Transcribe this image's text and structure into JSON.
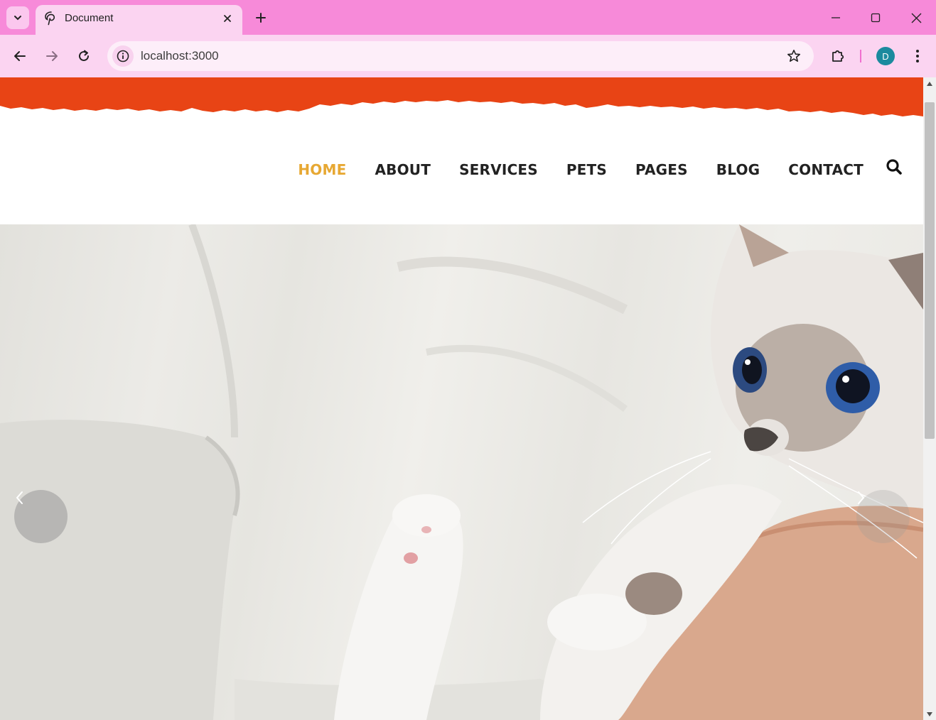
{
  "browser": {
    "tab_title": "Document",
    "url": "localhost:3000",
    "profile_initial": "D",
    "favicon": "pinterest-style-p-icon",
    "theme_color": "#f78ad9"
  },
  "site": {
    "accent_color": "#e84415",
    "active_color": "#e7a833",
    "nav": {
      "home": "HOME",
      "about": "ABOUT",
      "services": "SERVICES",
      "pets": "PETS",
      "pages": "PAGES",
      "blog": "BLOG",
      "contact": "CONTACT"
    },
    "search_icon": "search-icon"
  },
  "hero": {
    "carousel_prev_icon": "chevron-left-icon",
    "carousel_next_icon": "chevron-right-icon"
  }
}
